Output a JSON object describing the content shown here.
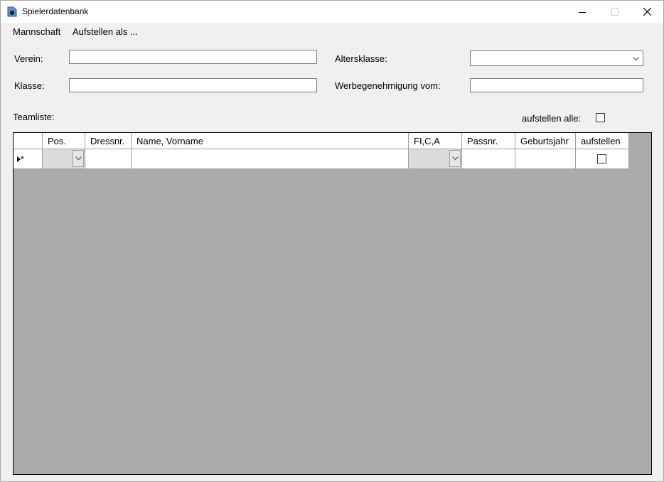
{
  "window": {
    "title": "Spielerdatenbank"
  },
  "menu": {
    "items": [
      "Mannschaft",
      "Aufstellen als ..."
    ]
  },
  "form": {
    "verein_label": "Verein:",
    "verein_value": "",
    "klasse_label": "Klasse:",
    "klasse_value": "",
    "altersklasse_label": "Altersklasse:",
    "altersklasse_value": "",
    "werbe_label": "Werbegenehmigung vom:",
    "werbe_value": "",
    "teamliste_label": "Teamliste:",
    "aufstellen_alle_label": "aufstellen alle:",
    "aufstellen_alle_checked": false
  },
  "grid": {
    "columns": [
      "Pos.",
      "Dressnr.",
      "Name, Vorname",
      "FI,C,A",
      "Passnr.",
      "Geburtsjahr",
      "aufstellen"
    ],
    "new_row_marker": "*",
    "rows": []
  },
  "colors": {
    "grid_background": "#ababab",
    "window_background": "#f0f0f0"
  },
  "icons": [
    "app-icon",
    "minimize-icon",
    "maximize-icon",
    "close-icon",
    "chevron-down-icon",
    "row-pointer-icon"
  ]
}
